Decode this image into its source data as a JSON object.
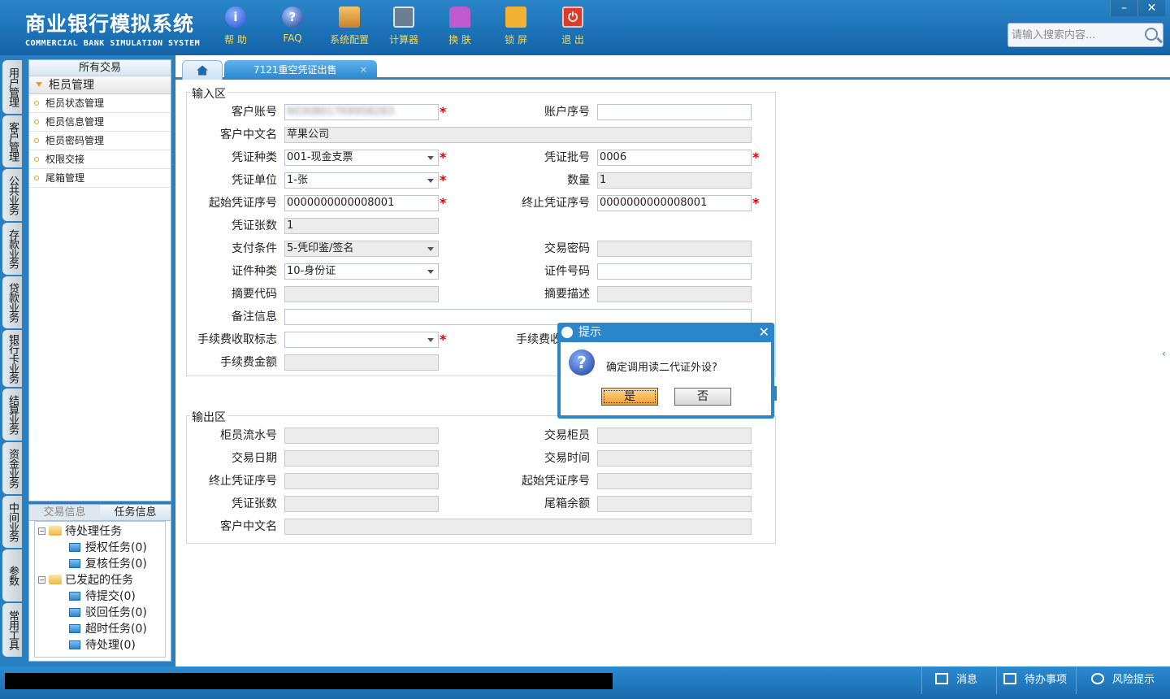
{
  "app": {
    "title_cn": "商业银行模拟系统",
    "title_en": "COMMERCIAL BANK SIMULATION SYSTEM"
  },
  "toolbar": [
    {
      "label": "帮 助",
      "icon": "help-icon",
      "glyph": "i"
    },
    {
      "label": "FAQ",
      "icon": "faq-icon",
      "glyph": "?"
    },
    {
      "label": "系统配置",
      "icon": "config-icon",
      "glyph": ""
    },
    {
      "label": "计算器",
      "icon": "calculator-icon",
      "glyph": ""
    },
    {
      "label": "换 肤",
      "icon": "skin-icon",
      "glyph": ""
    },
    {
      "label": "锁 屏",
      "icon": "lock-icon",
      "glyph": ""
    },
    {
      "label": "退 出",
      "icon": "exit-icon",
      "glyph": "⏻"
    }
  ],
  "window": {
    "minimize": "–",
    "close": "✕"
  },
  "search": {
    "placeholder": "请输入搜索内容..."
  },
  "vtabs": [
    "用户管理",
    "客户管理",
    "公共业务",
    "存款业务",
    "贷款业务",
    "银行卡业务",
    "结算业务",
    "资金业务",
    "中间业务",
    "参数",
    "常用工具"
  ],
  "menu": {
    "header": "所有交易",
    "group": "柜员管理",
    "items": [
      "柜员状态管理",
      "柜员信息管理",
      "柜员密码管理",
      "权限交接",
      "尾箱管理"
    ]
  },
  "tasks": {
    "tabs": [
      "交易信息",
      "任务信息"
    ],
    "pending": {
      "label": "待处理任务",
      "children": [
        "授权任务(0)",
        "复核任务(0)"
      ]
    },
    "initiated": {
      "label": "已发起的任务",
      "children": [
        "待提交(0)",
        "驳回任务(0)",
        "超时任务(0)",
        "待处理(0)"
      ]
    }
  },
  "tabs": {
    "active": "7121重空凭证出售",
    "close": "×"
  },
  "input_area": {
    "title": "输入区",
    "customer_account": {
      "label": "客户账号",
      "value": "6030801769958283"
    },
    "account_seq": {
      "label": "账户序号",
      "value": ""
    },
    "customer_name": {
      "label": "客户中文名",
      "value": "苹果公司"
    },
    "voucher_type": {
      "label": "凭证种类",
      "value": "001-现金支票"
    },
    "voucher_batch": {
      "label": "凭证批号",
      "value": "0006"
    },
    "voucher_unit": {
      "label": "凭证单位",
      "value": "1-张"
    },
    "quantity": {
      "label": "数量",
      "value": "1"
    },
    "start_seq": {
      "label": "起始凭证序号",
      "value": "0000000000008001"
    },
    "end_seq": {
      "label": "终止凭证序号",
      "value": "0000000000008001"
    },
    "voucher_count": {
      "label": "凭证张数",
      "value": "1"
    },
    "pay_condition": {
      "label": "支付条件",
      "value": "5-凭印鉴/签名"
    },
    "trade_password": {
      "label": "交易密码",
      "value": ""
    },
    "id_type": {
      "label": "证件种类",
      "value": "10-身份证"
    },
    "id_number": {
      "label": "证件号码",
      "value": ""
    },
    "summary_code": {
      "label": "摘要代码",
      "value": ""
    },
    "summary_desc": {
      "label": "摘要描述",
      "value": ""
    },
    "remark": {
      "label": "备注信息",
      "value": ""
    },
    "fee_flag": {
      "label": "手续费收取标志",
      "value": ""
    },
    "fee_method": {
      "label": "手续费收",
      "value": ""
    },
    "fee_amount": {
      "label": "手续费金额",
      "value": ""
    }
  },
  "output_area": {
    "title": "输出区",
    "teller_serial": {
      "label": "柜员流水号",
      "value": ""
    },
    "trade_teller": {
      "label": "交易柜员",
      "value": ""
    },
    "trade_date": {
      "label": "交易日期",
      "value": ""
    },
    "trade_time": {
      "label": "交易时间",
      "value": ""
    },
    "end_seq": {
      "label": "终止凭证序号",
      "value": ""
    },
    "start_seq": {
      "label": "起始凭证序号",
      "value": ""
    },
    "voucher_count": {
      "label": "凭证张数",
      "value": ""
    },
    "box_balance": {
      "label": "尾箱余额",
      "value": ""
    },
    "customer_name": {
      "label": "客户中文名",
      "value": ""
    }
  },
  "dialog": {
    "title": "提示",
    "message": "确定调用读二代证外设?",
    "yes": "是",
    "no": "否",
    "close": "✕"
  },
  "statusbar": {
    "message": "消息",
    "todo": "待办事项",
    "risk": "风险提示"
  }
}
